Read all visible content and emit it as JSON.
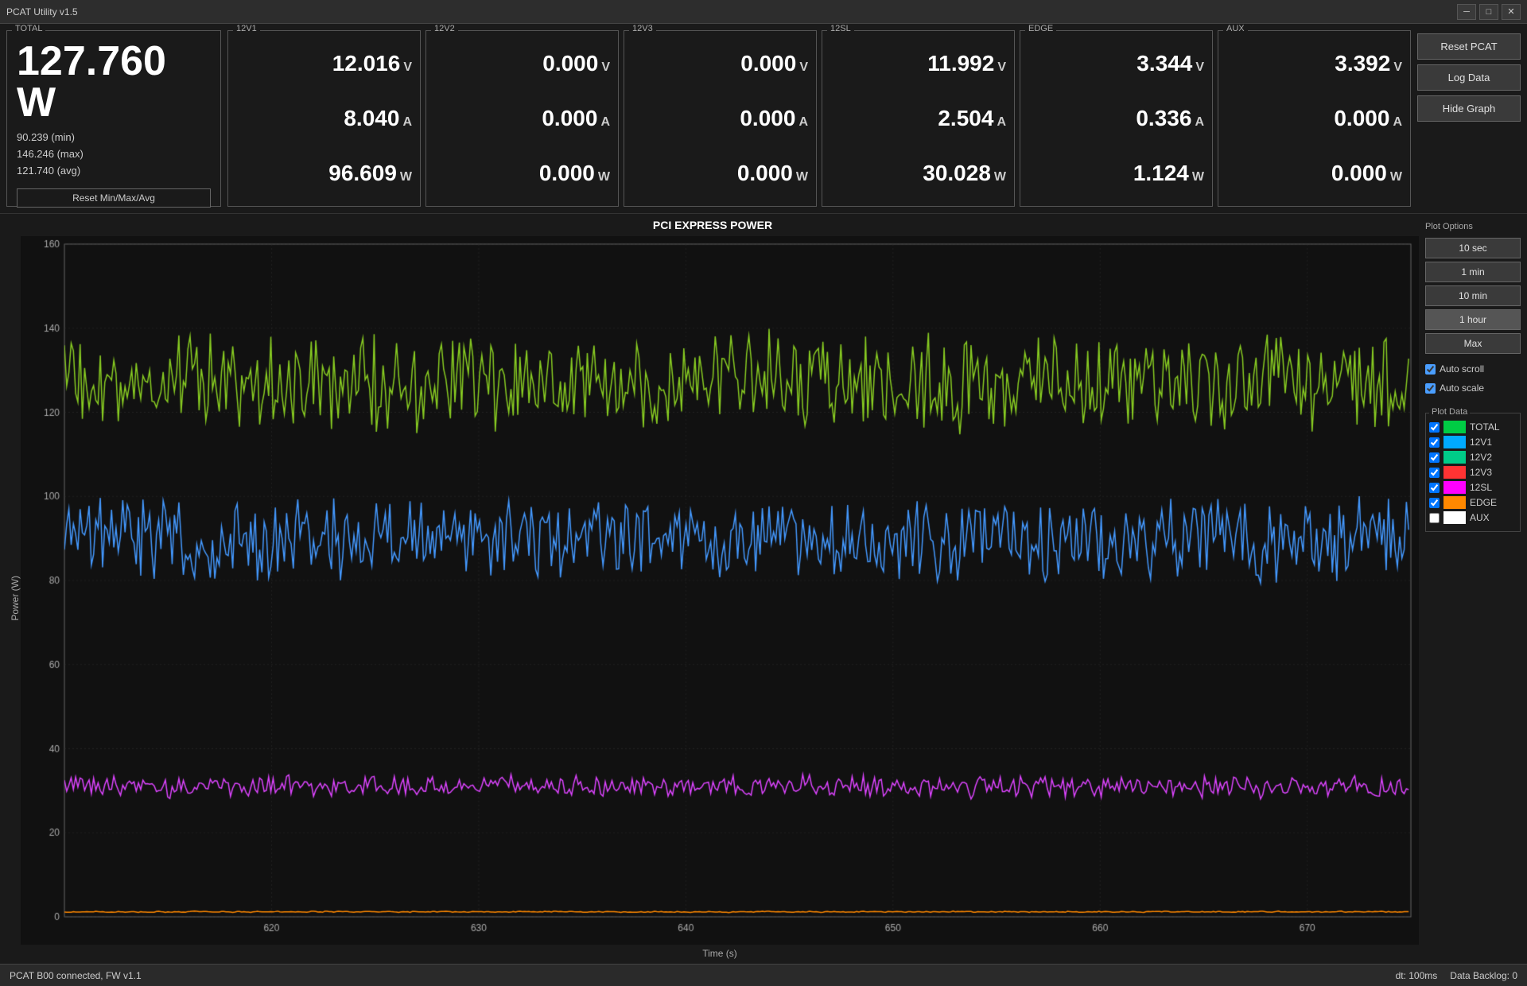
{
  "titleBar": {
    "title": "PCAT Utility v1.5",
    "minimizeLabel": "─",
    "maximizeLabel": "□",
    "closeLabel": "✕"
  },
  "total": {
    "label": "TOTAL",
    "watts": "127.760 W",
    "min": "90.239 (min)",
    "max": "146.246 (max)",
    "avg": "121.740 (avg)",
    "resetBtn": "Reset Min/Max/Avg"
  },
  "channels": [
    {
      "label": "12V1",
      "voltage": "12.016",
      "current": "8.040",
      "power": "96.609",
      "vUnit": "V",
      "aUnit": "A",
      "wUnit": "W"
    },
    {
      "label": "12V2",
      "voltage": "0.000",
      "current": "0.000",
      "power": "0.000",
      "vUnit": "V",
      "aUnit": "A",
      "wUnit": "W"
    },
    {
      "label": "12V3",
      "voltage": "0.000",
      "current": "0.000",
      "power": "0.000",
      "vUnit": "V",
      "aUnit": "A",
      "wUnit": "W"
    },
    {
      "label": "12SL",
      "voltage": "11.992",
      "current": "2.504",
      "power": "30.028",
      "vUnit": "V",
      "aUnit": "A",
      "wUnit": "W"
    },
    {
      "label": "EDGE",
      "voltage": "3.344",
      "current": "0.336",
      "power": "1.124",
      "vUnit": "V",
      "aUnit": "A",
      "wUnit": "W"
    },
    {
      "label": "AUX",
      "voltage": "3.392",
      "current": "0.000",
      "power": "0.000",
      "vUnit": "V",
      "aUnit": "A",
      "wUnit": "W"
    }
  ],
  "actionButtons": {
    "resetPCAT": "Reset PCAT",
    "logData": "Log Data",
    "hideGraph": "Hide Graph"
  },
  "graph": {
    "title": "PCI EXPRESS POWER",
    "xAxisLabel": "Time (s)",
    "yAxisLabel": "Power (W)",
    "xMin": 610,
    "xMax": 675,
    "yMin": 0,
    "yMax": 160,
    "xTicks": [
      620,
      630,
      640,
      650,
      660,
      670
    ],
    "yTicks": [
      0,
      20,
      40,
      60,
      80,
      100,
      120,
      140,
      160
    ]
  },
  "plotOptions": {
    "sectionLabel": "Plot Options",
    "buttons": [
      "10 sec",
      "1 min",
      "10 min",
      "1 hour",
      "Max"
    ],
    "autoScroll": {
      "label": "Auto scroll",
      "checked": true
    },
    "autoScale": {
      "label": "Auto scale",
      "checked": true
    }
  },
  "plotData": {
    "sectionLabel": "Plot Data",
    "items": [
      {
        "label": "TOTAL",
        "color": "#00cc44",
        "checked": true
      },
      {
        "label": "12V1",
        "color": "#00aaff",
        "checked": true
      },
      {
        "label": "12V2",
        "color": "#00cc88",
        "checked": true
      },
      {
        "label": "12V3",
        "color": "#ff3333",
        "checked": true
      },
      {
        "label": "12SL",
        "color": "#ff00ff",
        "checked": true
      },
      {
        "label": "EDGE",
        "color": "#ff8800",
        "checked": true
      },
      {
        "label": "AUX",
        "color": "#ffffff",
        "checked": false
      }
    ]
  },
  "statusBar": {
    "leftText": "PCAT B00 connected, FW v1.1",
    "dt": "dt: 100ms",
    "backlog": "Data Backlog: 0"
  }
}
